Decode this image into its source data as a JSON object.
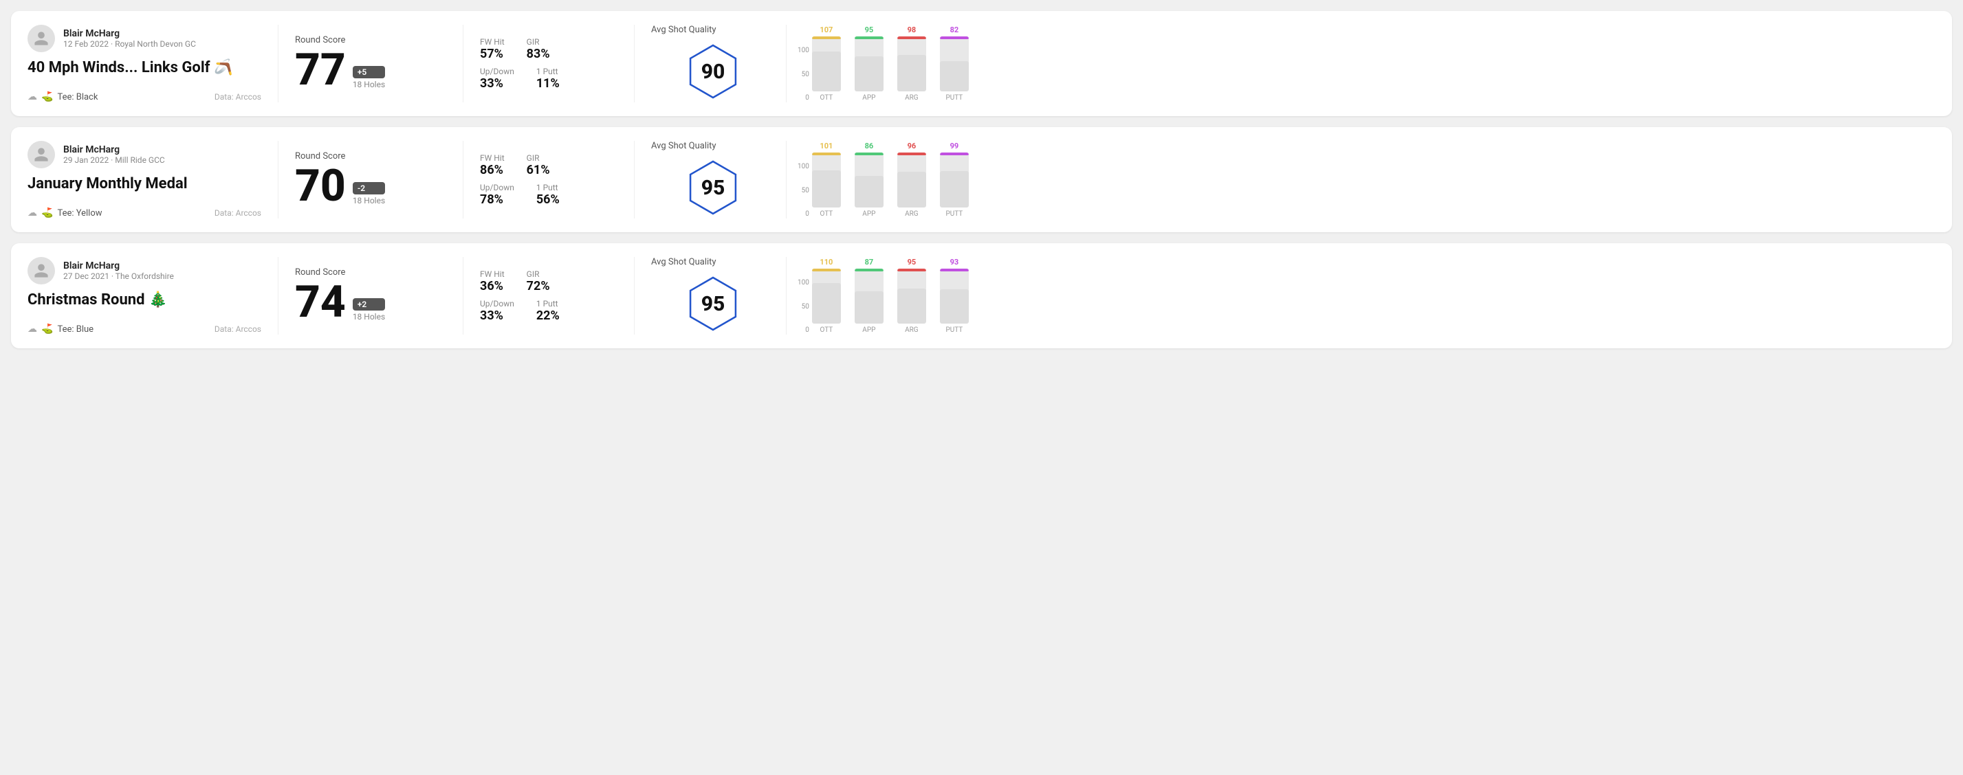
{
  "rounds": [
    {
      "id": "round1",
      "user_name": "Blair McHarg",
      "user_date": "12 Feb 2022 · Royal North Devon GC",
      "round_title": "40 Mph Winds... Links Golf 🪃",
      "tee": "Tee: Black",
      "data_source": "Data: Arccos",
      "round_score_label": "Round Score",
      "score": "77",
      "score_badge": "+5",
      "score_badge_type": "positive",
      "holes": "18 Holes",
      "fw_hit_label": "FW Hit",
      "fw_hit_value": "57%",
      "gir_label": "GIR",
      "gir_value": "83%",
      "updown_label": "Up/Down",
      "updown_value": "33%",
      "oneputt_label": "1 Putt",
      "oneputt_value": "11%",
      "quality_label": "Avg Shot Quality",
      "quality_score": "90",
      "bars": [
        {
          "label": "OTT",
          "value": 107,
          "color": "#e6c050"
        },
        {
          "label": "APP",
          "value": 95,
          "color": "#50c878"
        },
        {
          "label": "ARG",
          "value": 98,
          "color": "#e05050"
        },
        {
          "label": "PUTT",
          "value": 82,
          "color": "#c050e0"
        }
      ]
    },
    {
      "id": "round2",
      "user_name": "Blair McHarg",
      "user_date": "29 Jan 2022 · Mill Ride GCC",
      "round_title": "January Monthly Medal",
      "tee": "Tee: Yellow",
      "data_source": "Data: Arccos",
      "round_score_label": "Round Score",
      "score": "70",
      "score_badge": "-2",
      "score_badge_type": "negative",
      "holes": "18 Holes",
      "fw_hit_label": "FW Hit",
      "fw_hit_value": "86%",
      "gir_label": "GIR",
      "gir_value": "61%",
      "updown_label": "Up/Down",
      "updown_value": "78%",
      "oneputt_label": "1 Putt",
      "oneputt_value": "56%",
      "quality_label": "Avg Shot Quality",
      "quality_score": "95",
      "bars": [
        {
          "label": "OTT",
          "value": 101,
          "color": "#e6c050"
        },
        {
          "label": "APP",
          "value": 86,
          "color": "#50c878"
        },
        {
          "label": "ARG",
          "value": 96,
          "color": "#e05050"
        },
        {
          "label": "PUTT",
          "value": 99,
          "color": "#c050e0"
        }
      ]
    },
    {
      "id": "round3",
      "user_name": "Blair McHarg",
      "user_date": "27 Dec 2021 · The Oxfordshire",
      "round_title": "Christmas Round 🎄",
      "tee": "Tee: Blue",
      "data_source": "Data: Arccos",
      "round_score_label": "Round Score",
      "score": "74",
      "score_badge": "+2",
      "score_badge_type": "positive",
      "holes": "18 Holes",
      "fw_hit_label": "FW Hit",
      "fw_hit_value": "36%",
      "gir_label": "GIR",
      "gir_value": "72%",
      "updown_label": "Up/Down",
      "updown_value": "33%",
      "oneputt_label": "1 Putt",
      "oneputt_value": "22%",
      "quality_label": "Avg Shot Quality",
      "quality_score": "95",
      "bars": [
        {
          "label": "OTT",
          "value": 110,
          "color": "#e6c050"
        },
        {
          "label": "APP",
          "value": 87,
          "color": "#50c878"
        },
        {
          "label": "ARG",
          "value": 95,
          "color": "#e05050"
        },
        {
          "label": "PUTT",
          "value": 93,
          "color": "#c050e0"
        }
      ]
    }
  ],
  "y_axis_labels": [
    "100",
    "50",
    "0"
  ]
}
